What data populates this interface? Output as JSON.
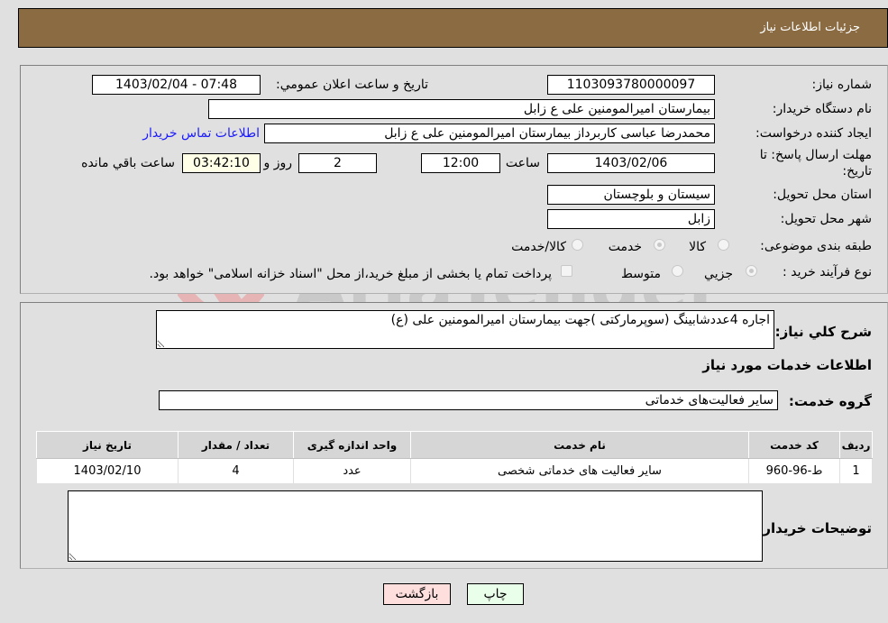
{
  "header": {
    "title": "جزئیات اطلاعات نیاز"
  },
  "form": {
    "need_number": {
      "label": "شماره نیاز:",
      "value": "1103093780000097"
    },
    "announce_datetime": {
      "label": "تاریخ و ساعت اعلان عمومي:",
      "value": "1403/02/04 - 07:48"
    },
    "buyer_org": {
      "label": "نام دستگاه خریدار:",
      "value": "بیمارستان امیرالمومنین علی  ع  زابل"
    },
    "requester": {
      "label": "ایجاد کننده درخواست:",
      "value": "محمدرضا عباسی کاربرداز بیمارستان امیرالمومنین علی  ع  زابل"
    },
    "buyer_contact_link": "اطلاعات تماس خریدار",
    "deadline": {
      "label_line1": "مهلت ارسال پاسخ: تا",
      "label_line2": "تاریخ:",
      "date": "1403/02/06",
      "time_label": "ساعت",
      "time": "12:00",
      "days": "2",
      "days_label": "روز و",
      "remaining": "03:42:10",
      "remaining_label": "ساعت باقي مانده"
    },
    "province": {
      "label": "استان محل تحویل:",
      "value": "سیستان و بلوچستان"
    },
    "city": {
      "label": "شهر محل تحویل:",
      "value": "زابل"
    },
    "category": {
      "label": "طبقه بندی موضوعی:",
      "options": [
        "کالا",
        "خدمت",
        "کالا/خدمت"
      ],
      "selected": "خدمت"
    },
    "purchase_type": {
      "label": "نوع فرآیند خرید :",
      "options": [
        "جزیي",
        "متوسط"
      ],
      "selected": "جزیي",
      "treasury_note": "پرداخت تمام یا بخشی از مبلغ خرید،از محل \"اسناد خزانه اسلامی\" خواهد بود."
    }
  },
  "details": {
    "summary_label": "شرح کلي نیاز:",
    "summary_value": "اجاره 4عددشابینگ (سوپرمارکتی )جهت بیمارستان امیرالمومنین علی (ع)",
    "services_heading": "اطلاعات خدمات مورد نیاز",
    "service_group_label": "گروه خدمت:",
    "service_group_value": "سایر فعالیت‌های خدماتی",
    "table": {
      "headers": [
        "ردیف",
        "کد خدمت",
        "نام خدمت",
        "واحد اندازه گیری",
        "تعداد / مقدار",
        "تاریخ نیاز"
      ],
      "rows": [
        [
          "1",
          "ط-96-960",
          "سایر فعالیت های خدماتی شخصی",
          "عدد",
          "4",
          "1403/02/10"
        ]
      ]
    },
    "buyer_notes_label": "توضیحات خریدار:",
    "buyer_notes_value": ""
  },
  "buttons": {
    "print": "چاپ",
    "back": "بازگشت"
  },
  "colors": {
    "header_bg": "#8b6b42",
    "print_bg": "#eaffea",
    "back_bg": "#ffdede",
    "link": "#1a1aff"
  }
}
